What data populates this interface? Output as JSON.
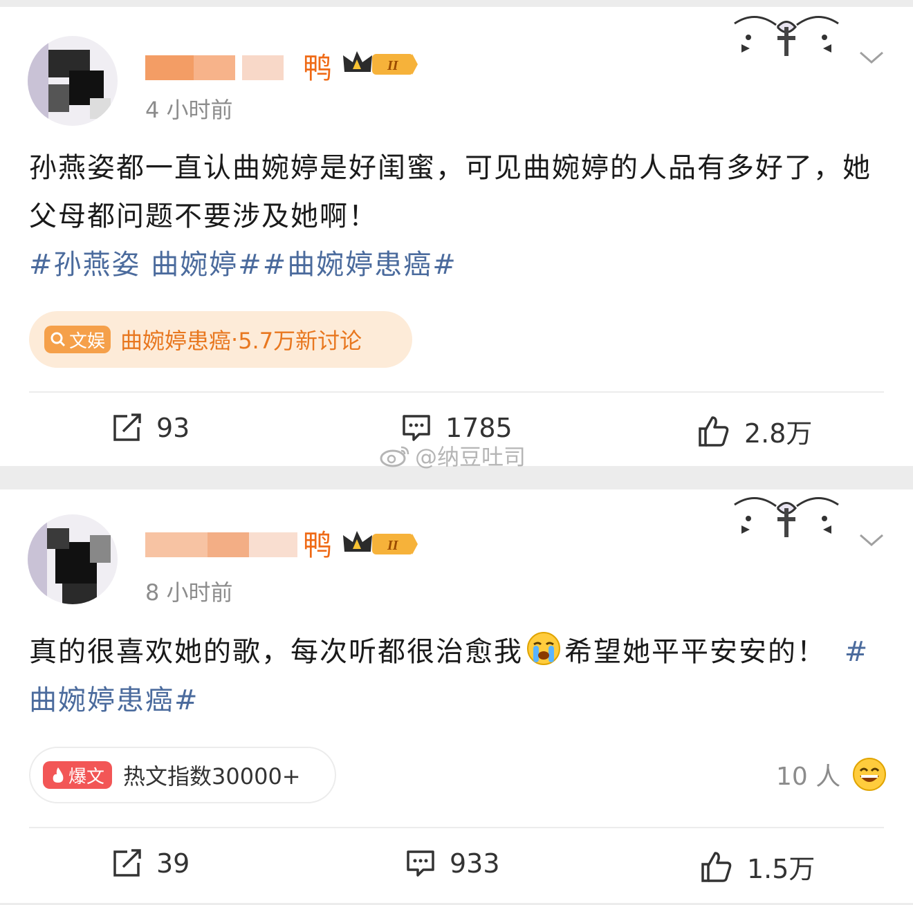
{
  "posts": [
    {
      "username_visible": "鸭",
      "time": "4 小时前",
      "text": "孙燕姿都一直认曲婉婷是好闺蜜，可见曲婉婷的人品有多好了，她父母都问题不要涉及她啊！",
      "tags": "#孙燕姿 曲婉婷##曲婉婷患癌#",
      "pill": {
        "badge": "文娱",
        "topic": "曲婉婷患癌",
        "sep": "·",
        "count": "5.7万新讨论"
      },
      "actions": {
        "repost": "93",
        "comment": "1785",
        "like": "2.8万"
      }
    },
    {
      "username_visible": "鸭",
      "time": "8 小时前",
      "text_a": "真的很喜欢她的歌，每次听都很治愈我",
      "text_b": "希望她平平安安的！",
      "tags": "#曲婉婷患癌#",
      "pill": {
        "badge": "爆文",
        "label": "热文指数30000+"
      },
      "reaction_count": "10 人",
      "actions": {
        "repost": "39",
        "comment": "933",
        "like": "1.5万"
      }
    }
  ],
  "badge_level": "II",
  "watermark": "@纳豆吐司",
  "icons": {
    "repost": "repost-icon",
    "comment": "comment-icon",
    "like": "thumbs-up-icon",
    "menu": "chevron-down-icon",
    "crown": "crown-badge-icon",
    "emoji_cry": "crying-emoji-icon",
    "emoji_grin": "grin-emoji-icon",
    "search": "search-icon",
    "fire": "fire-icon"
  },
  "colors": {
    "username": "#ef6a16",
    "tag": "#4b6b9d",
    "pill_orange": "#fde9d6",
    "pill_red": "#f05a5a"
  }
}
